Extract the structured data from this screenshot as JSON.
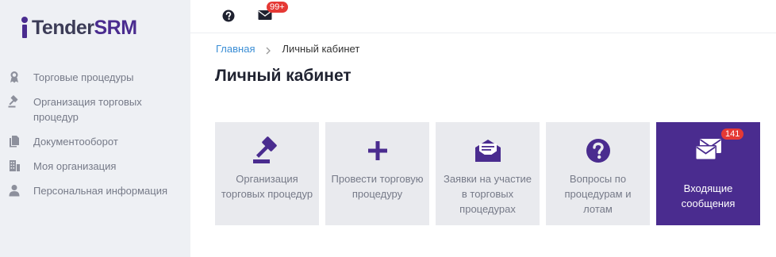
{
  "brand": {
    "name_part1": "Tender",
    "name_part2": "SRM",
    "color": "#4a2c8f"
  },
  "sidebar": {
    "items": [
      {
        "label": "Торговые процедуры",
        "icon": "award-icon"
      },
      {
        "label": "Организация торговых процедур",
        "icon": "gavel-icon"
      },
      {
        "label": "Документооборот",
        "icon": "documents-icon"
      },
      {
        "label": "Моя организация",
        "icon": "building-icon"
      },
      {
        "label": "Персональная информация",
        "icon": "user-icon"
      }
    ]
  },
  "topbar": {
    "help_icon": "help-icon",
    "mail_icon": "mail-icon",
    "mail_badge": "99+"
  },
  "breadcrumb": {
    "home": "Главная",
    "current": "Личный кабинет"
  },
  "page": {
    "title": "Личный кабинет"
  },
  "tiles": [
    {
      "label": "Организация торговых процедур",
      "icon": "gavel-icon"
    },
    {
      "label": "Провести торговую процедуру",
      "icon": "plus-icon"
    },
    {
      "label": "Заявки на участие в торговых процедурах",
      "icon": "envelope-open-icon"
    },
    {
      "label": "Вопросы по процедурам и лотам",
      "icon": "question-circle-icon"
    },
    {
      "label": "Входящие сообщения",
      "icon": "envelopes-icon",
      "badge": "141",
      "active": true
    }
  ],
  "colors": {
    "accent": "#4a2c8f",
    "badge": "#e53935",
    "link": "#3b8ed5"
  }
}
